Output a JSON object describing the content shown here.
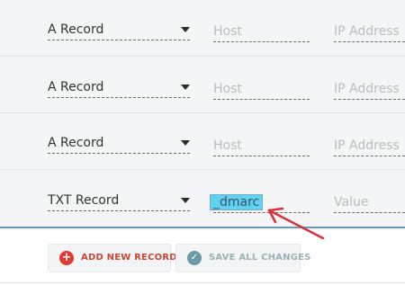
{
  "records": [
    {
      "type": "A Record",
      "host": "",
      "host_placeholder": "Host",
      "value_placeholder": "IP Address"
    },
    {
      "type": "A Record",
      "host": "",
      "host_placeholder": "Host",
      "value_placeholder": "IP Address"
    },
    {
      "type": "A Record",
      "host": "",
      "host_placeholder": "Host",
      "value_placeholder": "IP Address"
    },
    {
      "type": "TXT Record",
      "host": "_dmarc",
      "host_placeholder": "Host",
      "value_placeholder": "Value"
    }
  ],
  "actions": {
    "add_label": "ADD NEW RECORD",
    "add_icon": "+",
    "save_label": "SAVE ALL CHANGES",
    "save_icon": "✓"
  },
  "colors": {
    "accent_red": "#e23a30",
    "annotation_arrow": "#d9303a",
    "selection_highlight": "#5ed4f2"
  }
}
